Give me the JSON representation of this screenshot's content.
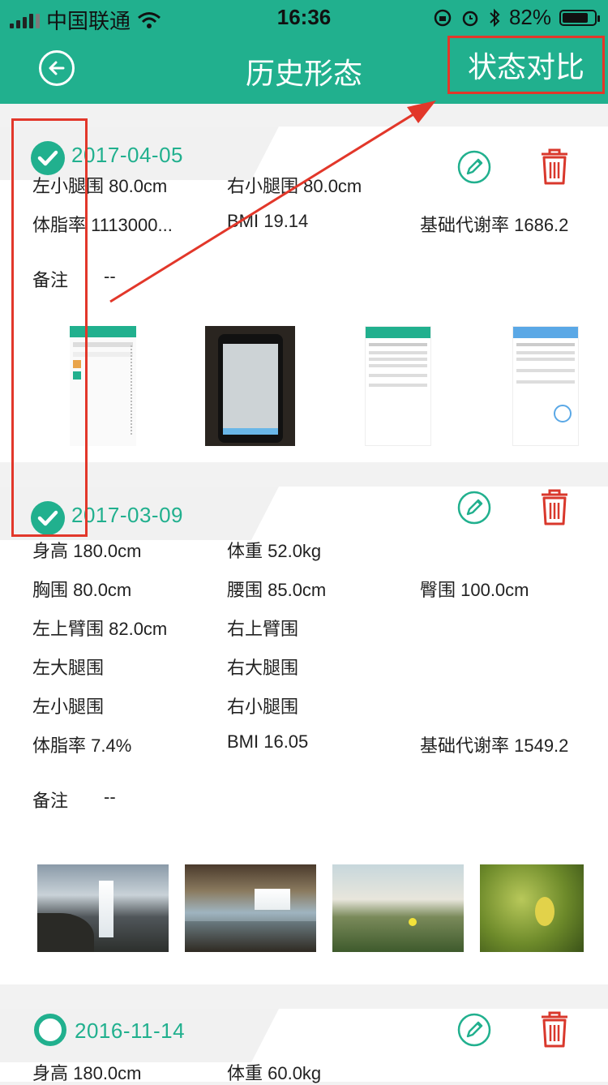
{
  "status_bar": {
    "carrier": "中国联通",
    "time": "16:36",
    "battery": "82%",
    "battery_level": 0.82
  },
  "navbar": {
    "title": "历史形态",
    "compare_label": "状态对比"
  },
  "records": [
    {
      "date": "2017-04-05",
      "checked": true,
      "fields": [
        [
          "左小腿围 80.0cm",
          "右小腿围 80.0cm",
          ""
        ],
        [
          "体脂率 1113000...",
          "BMI 19.14",
          "基础代谢率 1686.2"
        ]
      ],
      "note_label": "备注",
      "note_value": "--",
      "photos": [
        "app-screenshot-list",
        "phone-photo",
        "app-screenshot-form",
        "app-screenshot-detail"
      ]
    },
    {
      "date": "2017-03-09",
      "checked": true,
      "fields": [
        [
          "身高 180.0cm",
          "体重 52.0kg",
          ""
        ],
        [
          "胸围 80.0cm",
          "腰围 85.0cm",
          "臀围 100.0cm"
        ],
        [
          "左上臂围 82.0cm",
          "右上臂围",
          ""
        ],
        [
          "左大腿围",
          "右大腿围",
          ""
        ],
        [
          "左小腿围",
          "右小腿围",
          ""
        ],
        [
          "体脂率 7.4%",
          "BMI 16.05",
          "基础代谢率 1549.2"
        ]
      ],
      "note_label": "备注",
      "note_value": "--",
      "photos": [
        "waterfall-1",
        "waterfall-2",
        "grass-flower",
        "green-leaves"
      ]
    },
    {
      "date": "2016-11-14",
      "checked": false,
      "fields": [
        [
          "身高 180.0cm",
          "体重 60.0kg",
          ""
        ]
      ]
    }
  ],
  "colors": {
    "accent": "#21b08e",
    "annotation": "#e2372a",
    "delete": "#d9382c"
  }
}
